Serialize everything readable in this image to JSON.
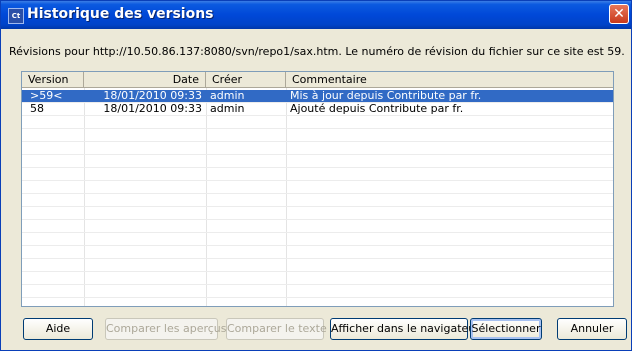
{
  "window": {
    "icon_label": "Ct",
    "title": "Historique des versions",
    "close_glyph": "✕"
  },
  "info_text": "Révisions pour http://10.50.86.137:8080/svn/repo1/sax.htm. Le numéro de révision du fichier sur ce site est 59.",
  "table": {
    "headers": {
      "version": "Version",
      "date": "Date",
      "creator": "Créer",
      "comment": "Commentaire"
    },
    "rows": [
      {
        "version": ">59<",
        "date": "18/01/2010 09:33",
        "creator": "admin",
        "comment": "Mis à jour depuis Contribute par fr."
      },
      {
        "version": "58",
        "date": "18/01/2010 09:33",
        "creator": "admin",
        "comment": "Ajouté depuis Contribute par fr."
      }
    ],
    "selected_row": 0
  },
  "buttons": {
    "help": "Aide",
    "compare_previews": "Comparer les aperçus",
    "compare_text": "Comparer le texte",
    "show_in_browser": "Afficher dans le navigateur",
    "select": "Sélectionner",
    "cancel": "Annuler"
  },
  "colors": {
    "titlebar": "#0048d8",
    "selection": "#316ac5",
    "dialog_bg": "#ece9d8"
  }
}
